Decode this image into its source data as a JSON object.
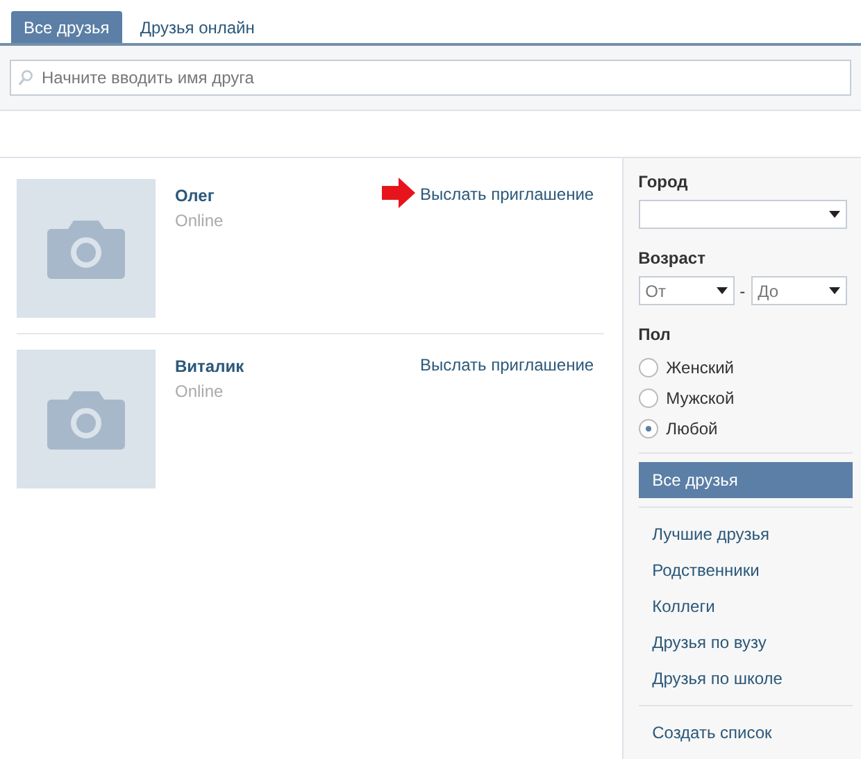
{
  "tabs": [
    {
      "label": "Все друзья",
      "selected": true
    },
    {
      "label": "Друзья онлайн",
      "selected": false
    }
  ],
  "search": {
    "placeholder": "Начните вводить имя друга"
  },
  "friends": [
    {
      "name": "Олег",
      "status": "Online",
      "action": "Выслать приглашение",
      "marked": true
    },
    {
      "name": "Виталик",
      "status": "Online",
      "action": "Выслать приглашение",
      "marked": false
    }
  ],
  "filters": {
    "city": {
      "label": "Город"
    },
    "age": {
      "label": "Возраст",
      "from": "От",
      "separator": "-",
      "to": "До"
    },
    "gender": {
      "label": "Пол",
      "options": [
        {
          "label": "Женский",
          "selected": false
        },
        {
          "label": "Мужской",
          "selected": false
        },
        {
          "label": "Любой",
          "selected": true
        }
      ]
    }
  },
  "lists": [
    {
      "label": "Все друзья",
      "selected": true
    },
    {
      "label": "Лучшие друзья",
      "selected": false
    },
    {
      "label": "Родственники",
      "selected": false
    },
    {
      "label": "Коллеги",
      "selected": false
    },
    {
      "label": "Друзья по вузу",
      "selected": false
    },
    {
      "label": "Друзья по школе",
      "selected": false
    }
  ],
  "create_list": "Создать список"
}
